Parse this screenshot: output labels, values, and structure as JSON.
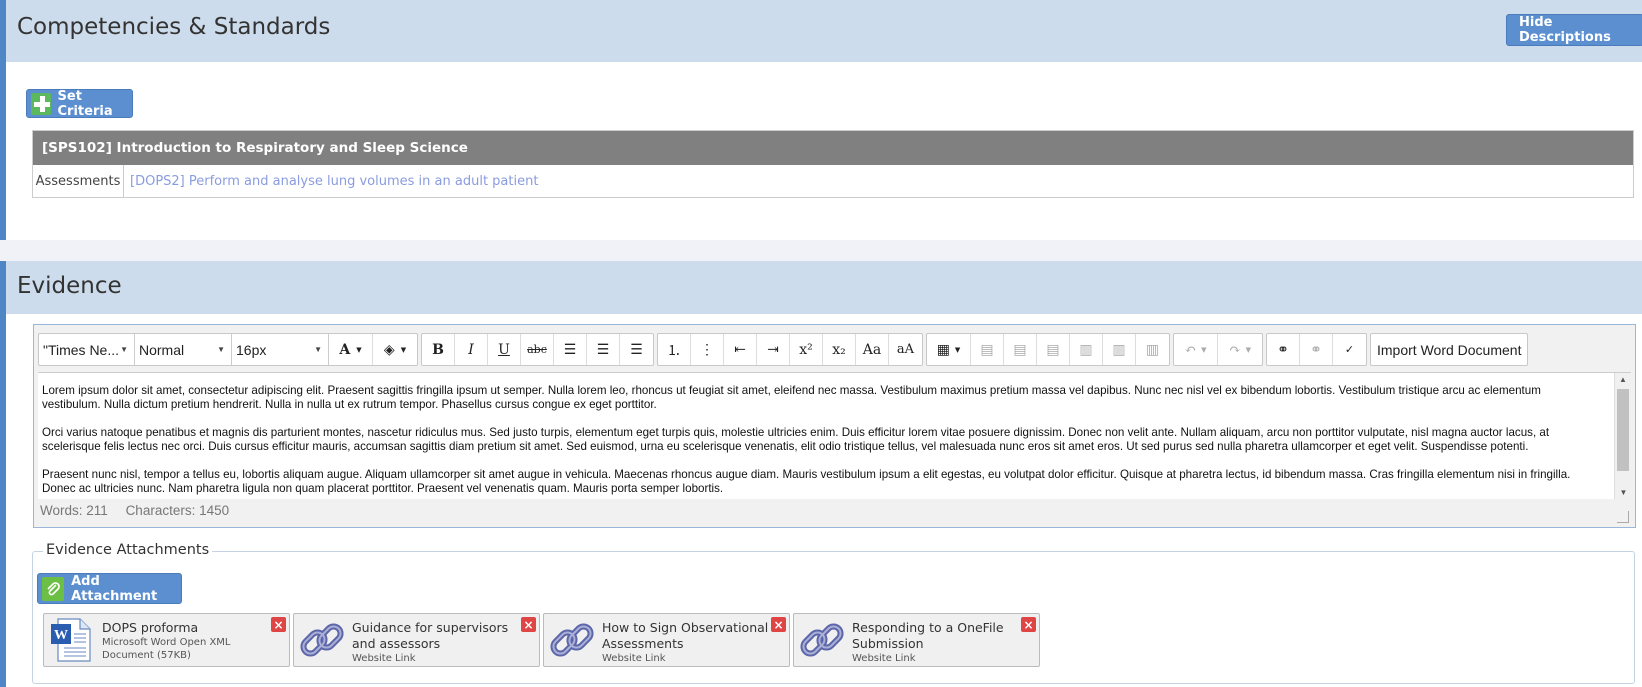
{
  "competencies": {
    "title": "Competencies & Standards",
    "hide_descriptions_label": "Hide Descriptions",
    "set_criteria_label": "Set Criteria",
    "course": {
      "heading": "[SPS102] Introduction to Respiratory and Sleep Science",
      "row_label": "Assessments",
      "row_value": "[DOPS2] Perform and analyse lung volumes in an adult patient"
    }
  },
  "evidence": {
    "title": "Evidence",
    "toolbar": {
      "font_family": "\"Times Ne...",
      "block_format": "Normal",
      "font_size": "16px",
      "import_label": "Import Word Document"
    },
    "body_paragraphs": [
      "Lorem ipsum dolor sit amet, consectetur adipiscing elit. Praesent sagittis fringilla ipsum ut semper. Nulla lorem leo, rhoncus ut feugiat sit amet, eleifend nec massa. Vestibulum maximus pretium massa vel dapibus. Nunc nec nisl vel ex bibendum lobortis. Vestibulum tristique arcu ac elementum vestibulum. Nulla dictum pretium hendrerit. Nulla in nulla ut ex rutrum tempor. Phasellus cursus congue ex eget porttitor.",
      "Orci varius natoque penatibus et magnis dis parturient montes, nascetur ridiculus mus. Sed justo turpis, elementum eget turpis quis, molestie ultricies enim. Duis efficitur lorem vitae posuere dignissim. Donec non velit ante. Nullam aliquam, arcu non porttitor vulputate, nisl magna auctor lacus, at scelerisque felis lectus nec orci. Duis cursus efficitur mauris, accumsan sagittis diam pretium sit amet. Sed euismod, urna eu scelerisque venenatis, elit odio tristique tellus, vel malesuada nunc eros sit amet eros. Ut sed purus sed nulla pharetra ullamcorper et eget velit. Suspendisse potenti.",
      "Praesent nunc nisl, tempor a tellus eu, lobortis aliquam augue. Aliquam ullamcorper sit amet augue in vehicula. Maecenas rhoncus augue diam. Mauris vestibulum ipsum a elit egestas, eu volutpat dolor efficitur. Quisque at pharetra lectus, id bibendum massa. Cras fringilla elementum nisi in fringilla. Donec ac ultricies nunc. Nam pharetra ligula non quam placerat porttitor. Praesent vel venenatis quam. Mauris porta semper lobortis."
    ],
    "word_count": "Words: 211",
    "char_count": "Characters: 1450",
    "attachments_title": "Evidence Attachments",
    "add_attachment_label": "Add Attachment",
    "attachments": [
      {
        "name": "DOPS proforma",
        "sub": "Microsoft Word Open XML Document (57KB)",
        "icon": "word-doc-icon"
      },
      {
        "name": "Guidance for supervisors and assessors",
        "sub": "Website Link",
        "icon": "link-icon"
      },
      {
        "name": "How to Sign Observational Assessments",
        "sub": "Website Link",
        "icon": "link-icon"
      },
      {
        "name": "Responding to a OneFile Submission",
        "sub": "Website Link",
        "icon": "link-icon"
      }
    ]
  },
  "colors": {
    "header_bg": "#cddcec",
    "accent_blue": "#5b8fd0",
    "course_header_bg": "#808080",
    "link_color": "#8a9ce0",
    "remove_red": "#e04545"
  }
}
